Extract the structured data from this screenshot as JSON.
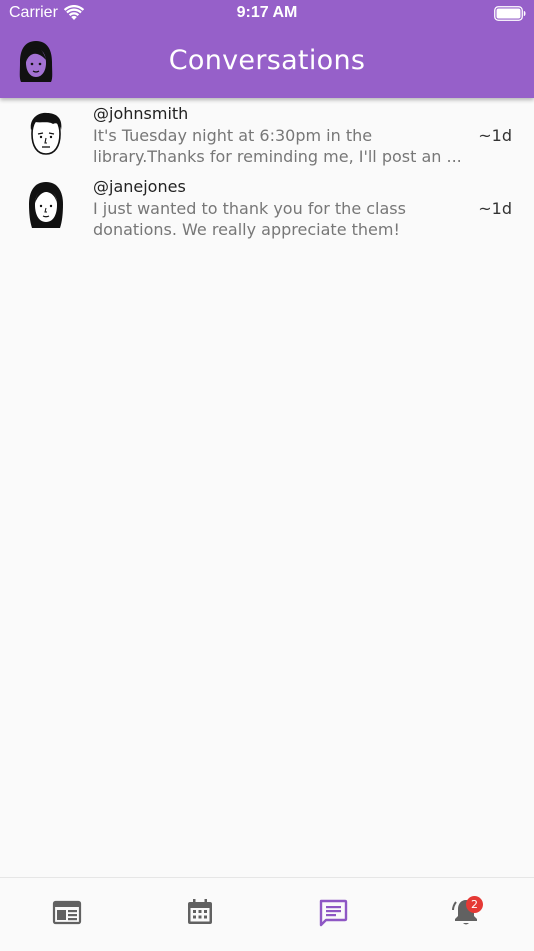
{
  "status_bar": {
    "carrier": "Carrier",
    "time": "9:17 AM"
  },
  "header": {
    "title": "Conversations",
    "background_color": "#9660c9"
  },
  "conversations": [
    {
      "username": "@johnsmith",
      "preview": "It's Tuesday night at 6:30pm in the library.Thanks for reminding me, I'll post an ...",
      "time": "~1d",
      "avatar_icon": "male-avatar-icon"
    },
    {
      "username": "@janejones",
      "preview": "I just wanted to thank you for the class donations. We really appreciate them!",
      "time": "~1d",
      "avatar_icon": "female-avatar-icon"
    }
  ],
  "bottom_nav": {
    "items": [
      {
        "name": "feed",
        "icon": "newspaper-icon",
        "active": false
      },
      {
        "name": "calendar",
        "icon": "calendar-icon",
        "active": false
      },
      {
        "name": "messages",
        "icon": "chat-icon",
        "active": true
      },
      {
        "name": "notifications",
        "icon": "bell-icon",
        "active": false
      }
    ],
    "notification_badge": "2",
    "active_color": "#8e57c4",
    "inactive_color": "#616161"
  }
}
